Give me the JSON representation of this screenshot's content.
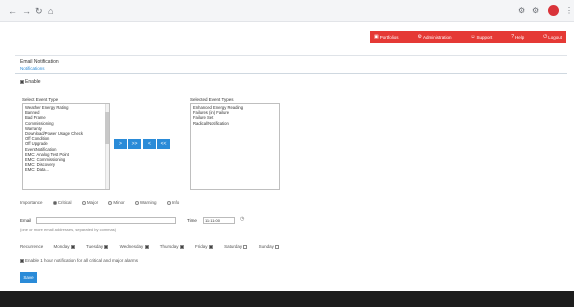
{
  "browser": {
    "nav_icons": [
      "back-icon",
      "forward-icon",
      "reload-icon",
      "home-icon"
    ],
    "nav_glyphs": [
      "←",
      "→",
      "↻",
      "⌂"
    ],
    "ext_glyph": "⚙",
    "menu_glyph": "⋮"
  },
  "topnav": {
    "items": [
      {
        "label": "Portfolios",
        "icon": "▣"
      },
      {
        "label": "Administration",
        "icon": "⚙"
      },
      {
        "label": "Support",
        "icon": "☺"
      },
      {
        "label": "Help",
        "icon": "?"
      },
      {
        "label": "Logout",
        "icon": "⏻"
      }
    ],
    "accent_color": "#e53935"
  },
  "panel": {
    "title": "Email Notification",
    "link": "Notifications"
  },
  "form": {
    "enable_label": "Enable",
    "select_types_label": "Select Event Type",
    "selected_types_label": "Selected Event Types",
    "available_types": [
      "Weather Energy Rating",
      "Banned",
      "Bad Frame",
      "Commissioning",
      "Warranty",
      "Download/Power Usage Check",
      "Off Condition",
      "Off Upgrade",
      "EventNotification",
      "EMC: Analog Test Point",
      "EMC: Commissioning",
      "EMC: Discovery",
      "EMC: Data..."
    ],
    "selected_types": [
      "Enhanced Energy Reading",
      "Failures (in) Failure",
      "Failure Set",
      "Radical/Notification"
    ],
    "move_buttons": [
      ">",
      ">>",
      "<",
      "<<"
    ],
    "importance_label": "Importance",
    "importance_options": [
      {
        "label": "Critical",
        "checked": true
      },
      {
        "label": "Major",
        "checked": false
      },
      {
        "label": "Minor",
        "checked": false
      },
      {
        "label": "Warning",
        "checked": false
      },
      {
        "label": "Info",
        "checked": false
      }
    ],
    "email_label": "Email",
    "email_value": "",
    "time_label": "Time",
    "time_value": "11:11:00",
    "email_hint": "(one or more email addresses, separated by commas)",
    "recurrence_label": "Recurrence",
    "days": [
      {
        "label": "Monday",
        "checked": true
      },
      {
        "label": "Tuesday",
        "checked": true
      },
      {
        "label": "Wednesday",
        "checked": true
      },
      {
        "label": "Thursday",
        "checked": true
      },
      {
        "label": "Friday",
        "checked": true
      },
      {
        "label": "Saturday",
        "checked": false
      },
      {
        "label": "Sunday",
        "checked": false
      }
    ],
    "same_day_label": "Enable 1 hour notification for all critical and major alarms",
    "save_label": "Save"
  }
}
